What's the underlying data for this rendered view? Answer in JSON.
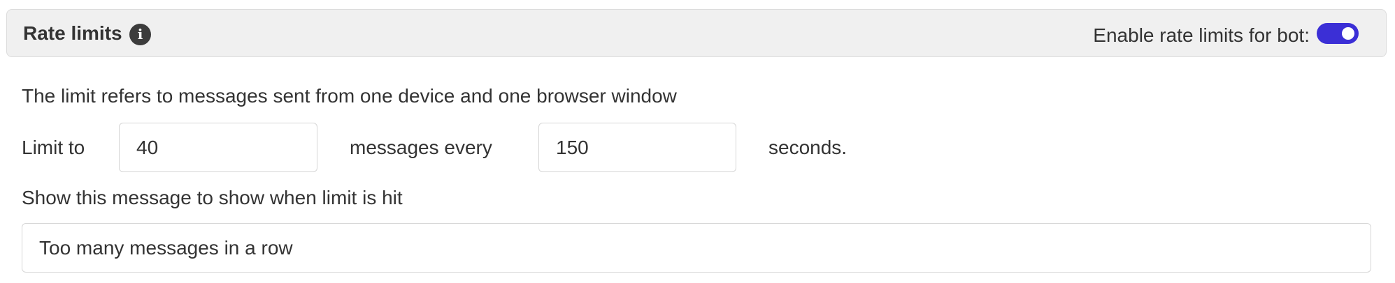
{
  "header": {
    "title": "Rate limits",
    "info_icon": "info-icon",
    "toggle_label": "Enable rate limits for bot:",
    "toggle_on": true,
    "accent_color": "#3b2fd6"
  },
  "description": "The limit refers to messages sent from one device and one browser window",
  "limit_row": {
    "prefix": "Limit to",
    "messages_value": "40",
    "middle": "messages every",
    "seconds_value": "150",
    "suffix": "seconds."
  },
  "message_section": {
    "label": "Show this message to show when limit is hit",
    "value": "Too many messages in a row"
  }
}
